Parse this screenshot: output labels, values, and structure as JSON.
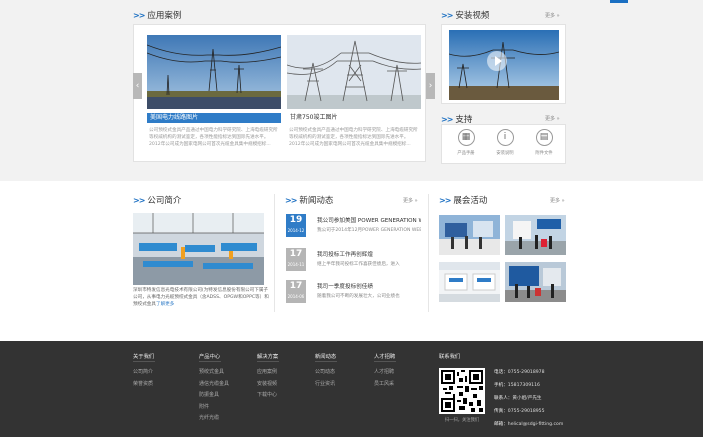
{
  "application": {
    "title": "应用案例",
    "cases": [
      {
        "name": "美国电力线路图片",
        "desc": "公司预绞式金具产品通过中国电力科学研究院、上海电缆研究所等权威机构的测试鉴定，各项性能指标达到国际先进水平。2012年公司成为国家电网公司首次光缆金具集中规模招标..."
      },
      {
        "name": "甘肃750竣工图片",
        "desc": "公司预绞式金具产品通过中国电力科学研究院、上海电缆研究所等权威机构的测试鉴定，各项性能指标达到国际先进水平。2012年公司成为国家电网公司首次光缆金具集中规模招标..."
      }
    ]
  },
  "video": {
    "title": "安装视频",
    "more": "更多"
  },
  "support": {
    "title": "支持",
    "more": "更多",
    "items": [
      {
        "label": "产品手册",
        "icon": "book-icon"
      },
      {
        "label": "安装说明",
        "icon": "info-icon"
      },
      {
        "label": "附件文件",
        "icon": "file-icon"
      }
    ]
  },
  "about": {
    "title": "公司简介",
    "text": "深圳市特发信息光电技术有限公司(为特发信息股份有限公司下属子公司，从事电力光缆预绞式金具（含ADSS、OPGW和OPPC等）和预绞式金具",
    "more": "了解更多"
  },
  "news": {
    "title": "新闻动态",
    "more": "更多",
    "items": [
      {
        "day": "19",
        "ym": "2014-12",
        "title": "我公司参加美国 POWER GENERATION WEEK",
        "summary": "我公司于2014年12月POWER GENERATION WEEK"
      },
      {
        "day": "17",
        "ym": "2014-11",
        "title": "我司投标工作再创辉煌",
        "summary": "继上半年我司投标工作喜获佳绩后，进入"
      },
      {
        "day": "17",
        "ym": "2014-06",
        "title": "我司一季度投标创佳绩",
        "summary": "随着我公司不断的发展壮大，公司业绩也"
      }
    ]
  },
  "expo": {
    "title": "展会活动",
    "more": "更多"
  },
  "footer": {
    "columns": [
      {
        "title": "关于我们",
        "items": [
          "公司简介",
          "荣誉资质"
        ]
      },
      {
        "title": "产品中心",
        "items": [
          "预绞式金具",
          "通信光缆金具",
          "防振金具",
          "附件",
          "光纤光缆"
        ]
      },
      {
        "title": "解决方案",
        "items": [
          "应用案例",
          "安装视频",
          "下载中心"
        ]
      },
      {
        "title": "新闻动态",
        "items": [
          "公司动态",
          "行业资讯"
        ]
      },
      {
        "title": "人才招聘",
        "items": [
          "人才招聘",
          "员工风采"
        ]
      }
    ],
    "contact_title": "联系我们",
    "qr_caption": "扫一扫，关注我们",
    "contact": [
      {
        "k": "电话：",
        "v": "0755-29018978"
      },
      {
        "k": "手机：",
        "v": "15817309116"
      },
      {
        "k": "联系人：",
        "v": "黄小姐/严先生"
      },
      {
        "k": "传真：",
        "v": "0755-29018955"
      },
      {
        "k": "邮箱：",
        "v": "helical@sdgi-fitting.com"
      }
    ]
  },
  "colors": {
    "accent": "#2f7cc7",
    "footer_bg": "#333333",
    "top_bg": "#f2f2f2"
  }
}
